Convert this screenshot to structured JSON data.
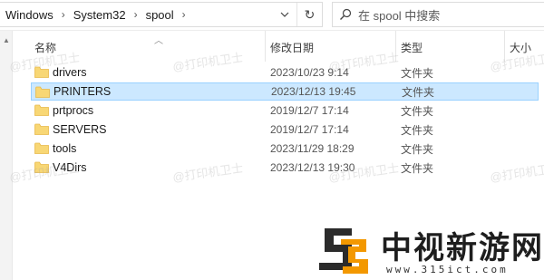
{
  "address_bar": {
    "crumbs": [
      "Windows",
      "System32",
      "spool"
    ],
    "dropdown_glyph": "⌄",
    "refresh_glyph": "↻"
  },
  "search": {
    "placeholder": "在 spool 中搜索"
  },
  "columns": {
    "name": "名称",
    "date": "修改日期",
    "type": "类型",
    "size": "大小"
  },
  "files": [
    {
      "name": "drivers",
      "date": "2023/10/23 9:14",
      "type": "文件夹",
      "selected": false
    },
    {
      "name": "PRINTERS",
      "date": "2023/12/13 19:45",
      "type": "文件夹",
      "selected": true
    },
    {
      "name": "prtprocs",
      "date": "2019/12/7 17:14",
      "type": "文件夹",
      "selected": false
    },
    {
      "name": "SERVERS",
      "date": "2019/12/7 17:14",
      "type": "文件夹",
      "selected": false
    },
    {
      "name": "tools",
      "date": "2023/11/29 18:29",
      "type": "文件夹",
      "selected": false
    },
    {
      "name": "V4Dirs",
      "date": "2023/12/13 19:30",
      "type": "文件夹",
      "selected": false
    }
  ],
  "watermark": {
    "text": "@打印机卫士"
  },
  "logo": {
    "title": "中视新游网",
    "url": "www.315ict.com"
  },
  "colors": {
    "selection": "#cce8ff",
    "folder": "#f8d775",
    "folder_dark": "#e8b94a",
    "logo_orange": "#f39800"
  }
}
